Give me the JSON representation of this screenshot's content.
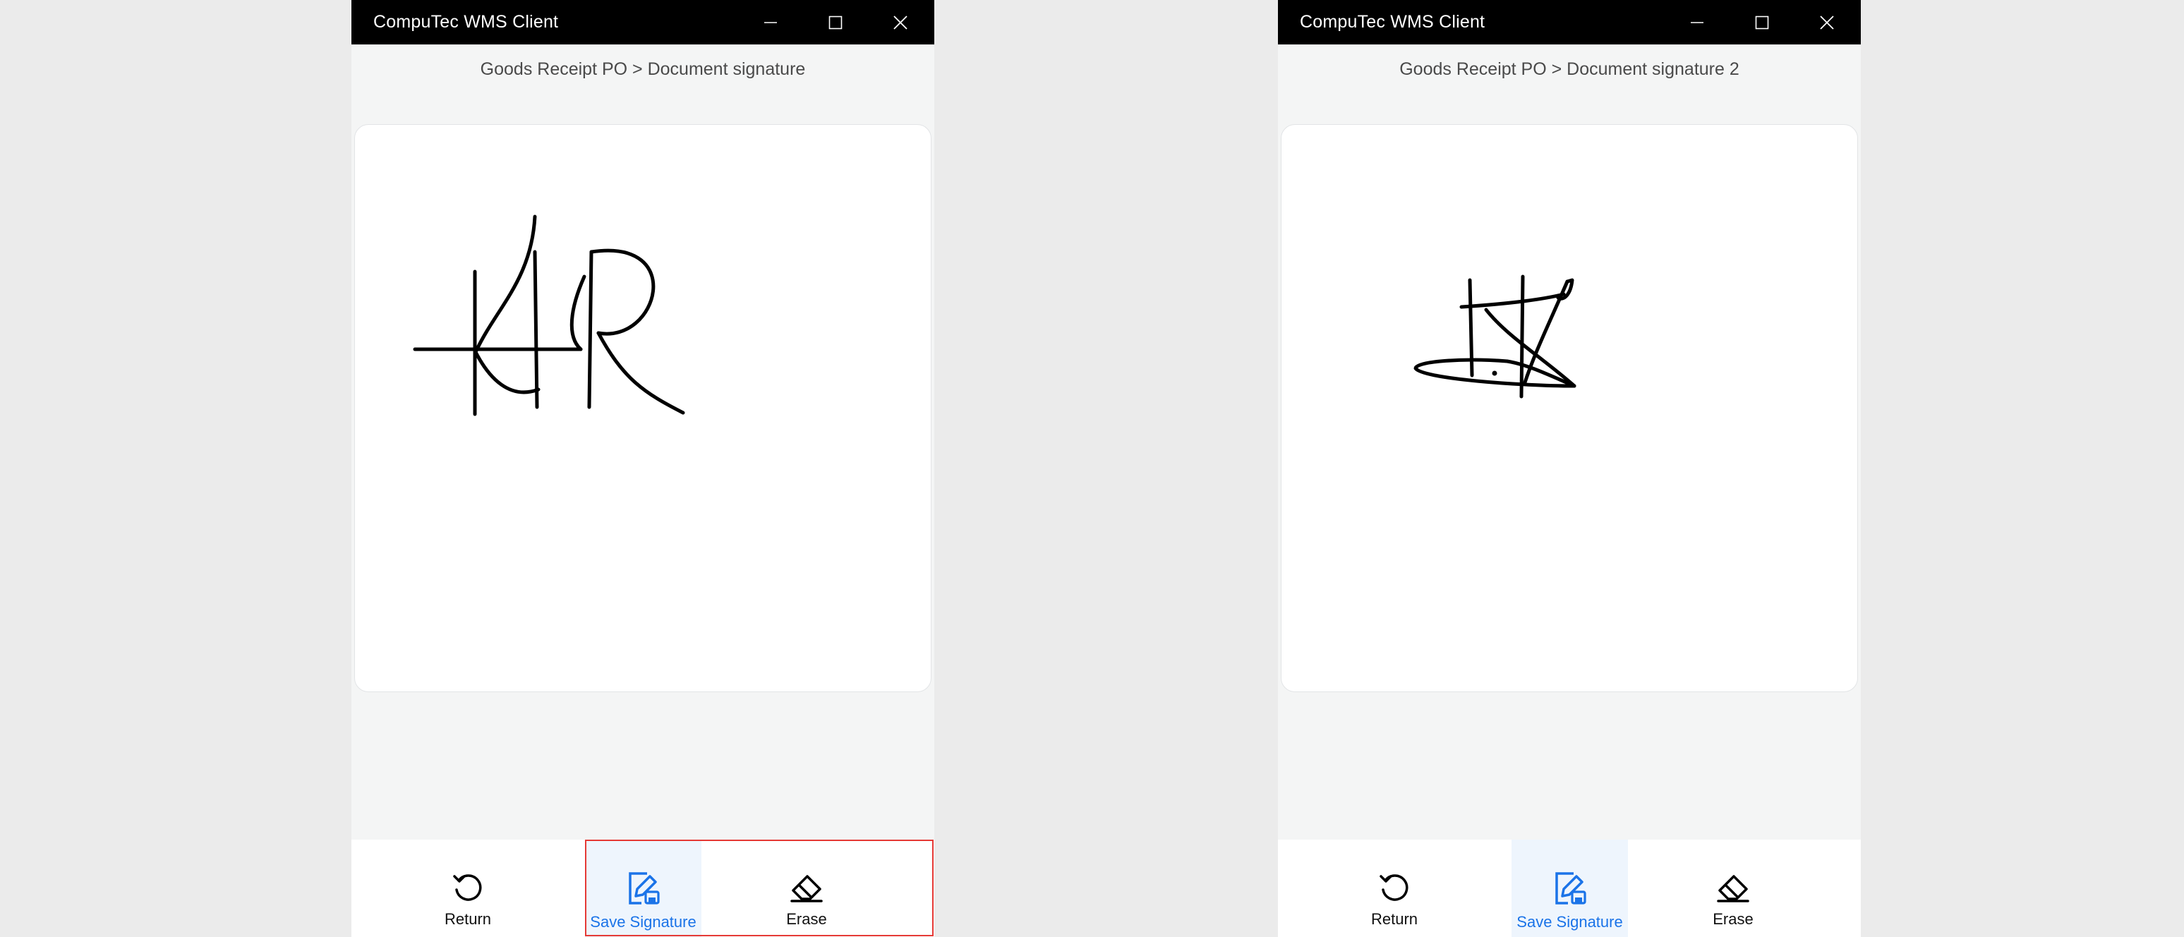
{
  "highlight_color": "#e53935",
  "accent_color": "#1a73e8",
  "windows": [
    {
      "title": "CompuTec WMS Client",
      "breadcrumb": "Goods Receipt PO > Document signature",
      "actions": {
        "return": "Return",
        "save": "Save Signature",
        "erase": "Erase"
      },
      "highlighted": true
    },
    {
      "title": "CompuTec WMS Client",
      "breadcrumb": "Goods Receipt PO > Document signature 2",
      "actions": {
        "return": "Return",
        "save": "Save Signature",
        "erase": "Erase"
      },
      "highlighted": false
    }
  ],
  "icons": {
    "minimize": "minimize-icon",
    "maximize": "maximize-icon",
    "close": "close-icon",
    "return": "undo-arrow-icon",
    "save": "signature-edit-icon",
    "erase": "eraser-icon"
  }
}
